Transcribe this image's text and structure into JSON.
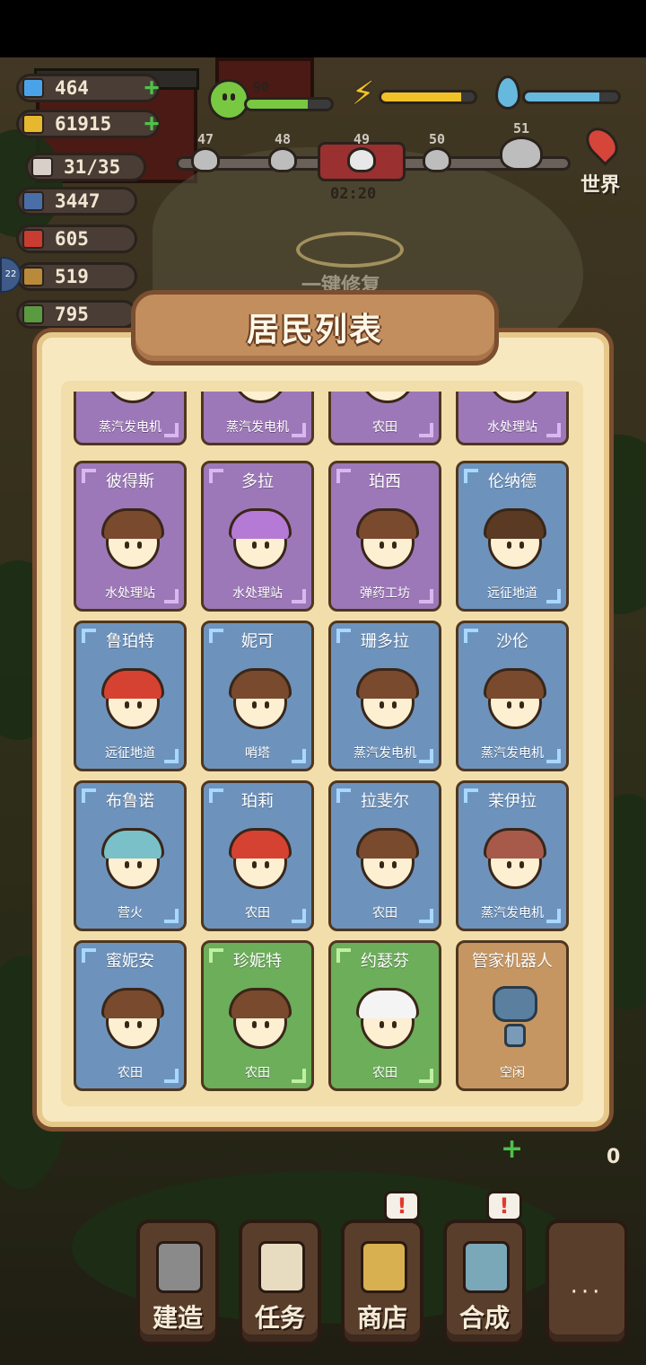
{
  "hud": {
    "resources": [
      {
        "id": "diamond",
        "value": "464",
        "color": "#4aa3e8",
        "has_plus": true
      },
      {
        "id": "coin",
        "value": "61915",
        "color": "#e8b730",
        "has_plus": true
      },
      {
        "id": "population",
        "value": "31/35",
        "color": "#d8d0c8",
        "has_plus": false
      },
      {
        "id": "ammo",
        "value": "3447",
        "color": "#4a6ea8",
        "has_plus": false
      },
      {
        "id": "food",
        "value": "605",
        "color": "#c83c32",
        "has_plus": false
      },
      {
        "id": "wood",
        "value": "519",
        "color": "#b88a3a",
        "has_plus": false
      },
      {
        "id": "herb",
        "value": "795",
        "color": "#5a9a40",
        "has_plus": false
      }
    ],
    "happiness_value": "90",
    "happiness_level": 0.72,
    "energy_level": 0.86,
    "water_level": 0.8,
    "waves": [
      "47",
      "48",
      "49",
      "50",
      "51"
    ],
    "active_wave": "49",
    "timer": "02:20",
    "world_label": "世界",
    "background_text": "一键修复"
  },
  "panel": {
    "title": "居民列表",
    "partial_row": [
      {
        "job": "蒸汽发电机",
        "theme": "purple"
      },
      {
        "job": "蒸汽发电机",
        "theme": "purple"
      },
      {
        "job": "农田",
        "theme": "purple"
      },
      {
        "job": "水处理站",
        "theme": "purple"
      }
    ],
    "residents": [
      {
        "name": "彼得斯",
        "job": "水处理站",
        "theme": "purple",
        "hair": "#7a4a2e"
      },
      {
        "name": "多拉",
        "job": "水处理站",
        "theme": "purple",
        "hair": "#b57ad6"
      },
      {
        "name": "珀西",
        "job": "弹药工坊",
        "theme": "purple",
        "hair": "#7a4a2e"
      },
      {
        "name": "伦纳德",
        "job": "远征地道",
        "theme": "blue",
        "hair": "#5a3a22"
      },
      {
        "name": "鲁珀特",
        "job": "远征地道",
        "theme": "blue",
        "hair": "#d64232"
      },
      {
        "name": "妮可",
        "job": "哨塔",
        "theme": "blue",
        "hair": "#7a4a2e"
      },
      {
        "name": "珊多拉",
        "job": "蒸汽发电机",
        "theme": "blue",
        "hair": "#7a4a2e"
      },
      {
        "name": "沙伦",
        "job": "蒸汽发电机",
        "theme": "blue",
        "hair": "#7a4a2e"
      },
      {
        "name": "布鲁诺",
        "job": "营火",
        "theme": "blue",
        "hair": "#7ac0c8"
      },
      {
        "name": "珀莉",
        "job": "农田",
        "theme": "blue",
        "hair": "#d64232"
      },
      {
        "name": "拉斐尔",
        "job": "农田",
        "theme": "blue",
        "hair": "#7a4a2e"
      },
      {
        "name": "茉伊拉",
        "job": "蒸汽发电机",
        "theme": "blue",
        "hair": "#a85a4a"
      },
      {
        "name": "蜜妮安",
        "job": "农田",
        "theme": "blue",
        "hair": "#7a4a2e"
      },
      {
        "name": "珍妮特",
        "job": "农田",
        "theme": "green",
        "hair": "#7a4a2e"
      },
      {
        "name": "约瑟芬",
        "job": "农田",
        "theme": "green",
        "hair": "#f4f4f4"
      },
      {
        "name": "管家机器人",
        "job": "空闲",
        "theme": "brown",
        "hair": "robot"
      }
    ]
  },
  "bottom_bar": [
    {
      "label": "建造",
      "icon": "shovel-icon",
      "alert": false,
      "color": "#8a8a8a"
    },
    {
      "label": "任务",
      "icon": "scroll-icon",
      "alert": false,
      "color": "#e8dcc0"
    },
    {
      "label": "商店",
      "icon": "coins-icon",
      "alert": true,
      "color": "#d8b050"
    },
    {
      "label": "合成",
      "icon": "machine-icon",
      "alert": true,
      "color": "#7aa8b8"
    },
    {
      "label": "",
      "icon": "more-icon",
      "alert": false,
      "color": "#5a3e2c"
    }
  ],
  "alert_mark": "!",
  "more_dots": "···",
  "side_plus": "+",
  "side_zero": "0"
}
